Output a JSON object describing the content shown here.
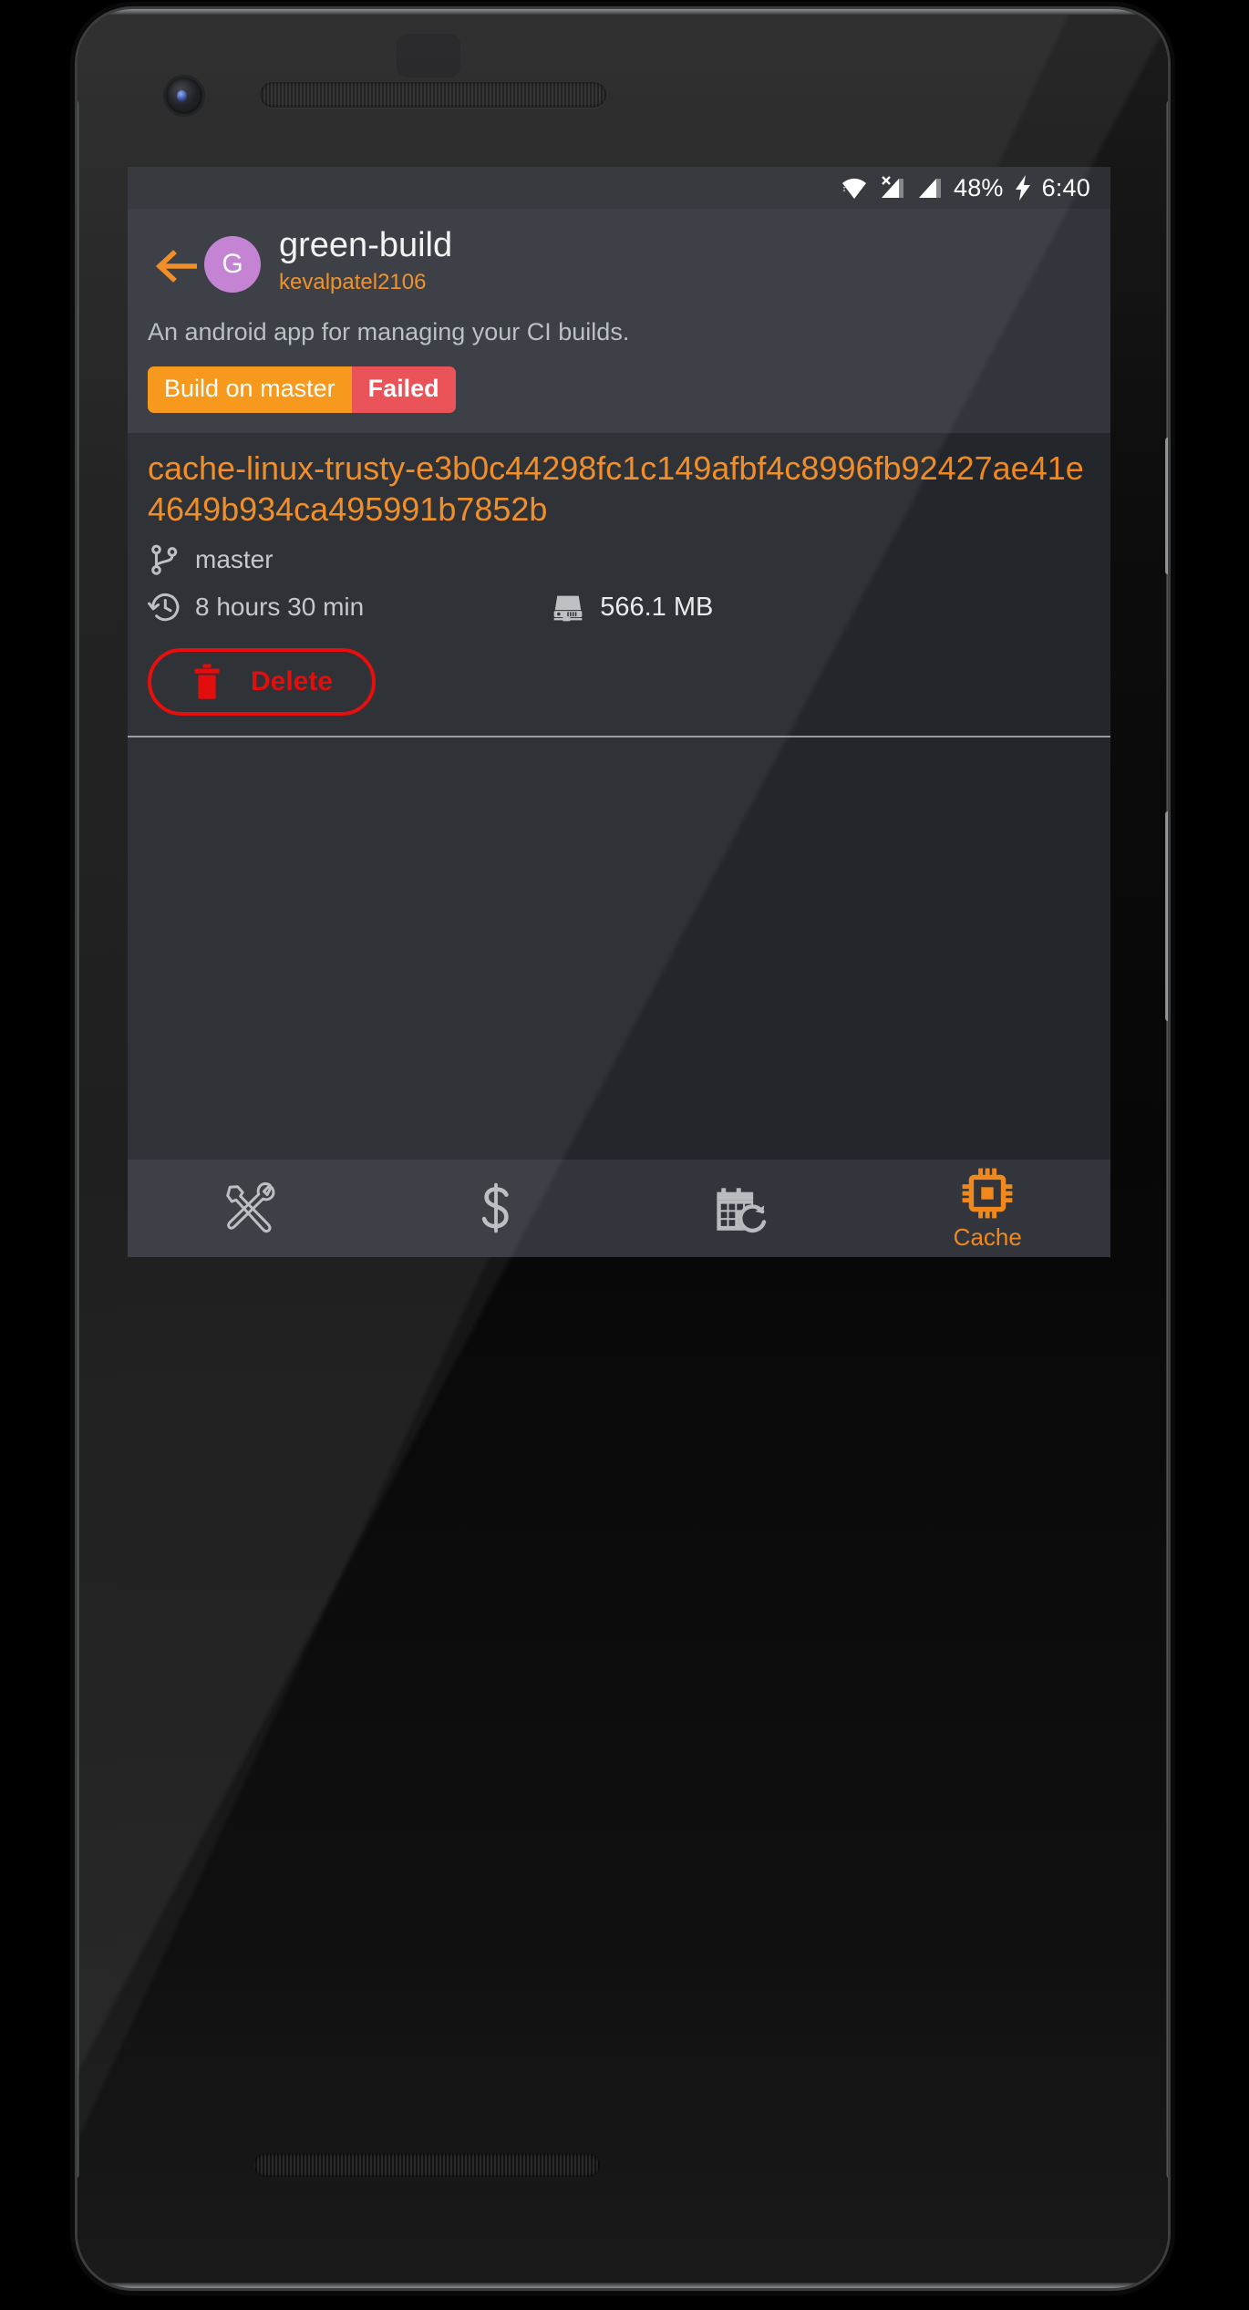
{
  "device": {
    "name": "android-phone-mockup"
  },
  "status_bar": {
    "wifi_icon": "wifi-icon",
    "signal_no_sim_icon": "signal-no-sim-icon",
    "signal_icon": "signal-bars-icon",
    "battery_percent": "48%",
    "charging_icon": "charging-bolt-icon",
    "clock": "6:40"
  },
  "app_bar": {
    "back_icon": "back-arrow-icon",
    "avatar_letter": "G",
    "avatar_color": "#c27cd2",
    "repo_title": "green-build",
    "repo_owner": "kevalpatel2106",
    "repo_description": "An android app for managing your CI builds.",
    "build_chip": {
      "build_label": "Build on master",
      "status_label": "Failed",
      "build_color": "#f79310",
      "status_color": "#e8494f"
    }
  },
  "cache_card": {
    "cache_name": "cache-linux-trusty-e3b0c44298fc1c149afbf4c8996fb92427ae41e4649b934ca495991b7852b",
    "branch_icon": "git-branch-icon",
    "branch": "master",
    "time_icon": "history-clock-icon",
    "time": "8 hours 30 min",
    "size_icon": "hard-drive-icon",
    "size": "566.1 MB",
    "delete_icon": "trash-icon",
    "delete_label": "Delete",
    "delete_color": "#e60000",
    "accent_color": "#f0881d"
  },
  "bottom_nav": {
    "items": [
      {
        "icon": "tools-wrench-screwdriver-icon",
        "label": "",
        "active": false
      },
      {
        "icon": "dollar-sign-icon",
        "label": "",
        "active": false
      },
      {
        "icon": "calendar-refresh-icon",
        "label": "",
        "active": false
      },
      {
        "icon": "cpu-chip-icon",
        "label": "Cache",
        "active": true
      }
    ],
    "active_color": "#f0881d",
    "inactive_color": "#b8bcbf"
  }
}
